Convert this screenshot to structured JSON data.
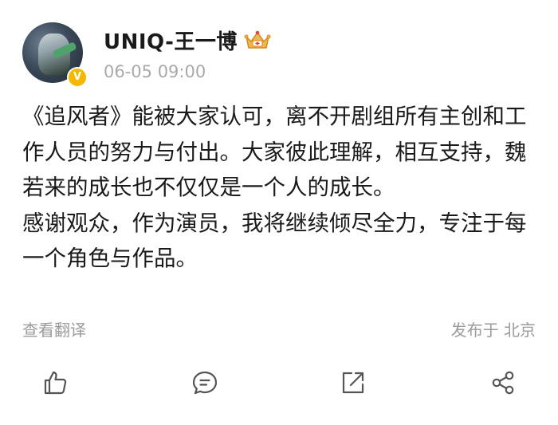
{
  "post": {
    "username": "UNIQ-王一博",
    "time": "06-05 09:00",
    "verify_badge": "V",
    "paragraphs": [
      "《追风者》能被大家认可，离不开剧组所有主创和工作人员的努力与付出。大家彼此理解，相互支持，魏若来的成长也不仅仅是一个人的成长。",
      "感谢观众，作为演员，我将继续倾尽全力，专注于每一个角色与作品。"
    ],
    "translate_label": "查看翻译",
    "location": "发布于 北京"
  },
  "actions": {
    "icons": [
      "like-icon",
      "comment-icon",
      "repost-icon",
      "share-icon"
    ]
  },
  "colors": {
    "text": "#1a1a1a",
    "muted": "#9b9b9b",
    "verify": "#f5b800",
    "icon": "#555555"
  }
}
